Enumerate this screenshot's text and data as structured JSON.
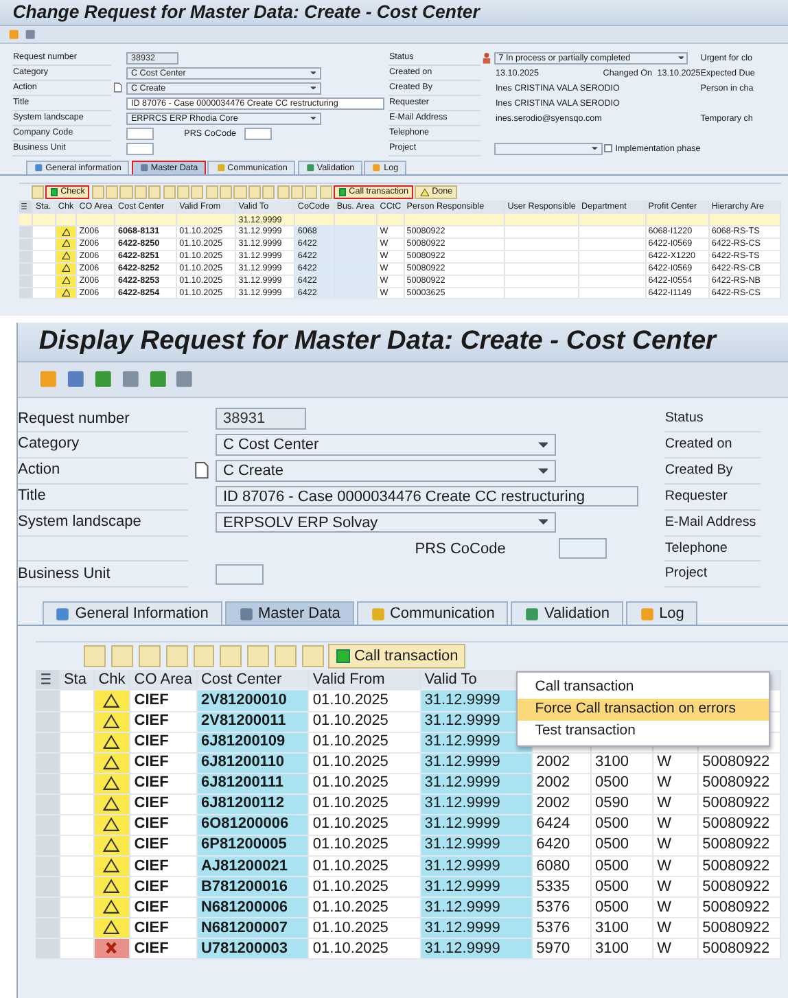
{
  "panels": [
    {
      "title": "Change Request for Master Data: Create - Cost Center",
      "form": [
        {
          "label": "Request number",
          "kind": "readonly",
          "value": "38932",
          "note_icon": false
        },
        {
          "label": "Category",
          "kind": "dropdown",
          "value": "C Cost Center",
          "note_icon": false
        },
        {
          "label": "Action",
          "kind": "dropdown",
          "value": "C Create",
          "note_icon": true
        },
        {
          "label": "Title",
          "kind": "long",
          "value": "ID 87076 - Case 0000034476 Create CC restructuring",
          "note_icon": false
        },
        {
          "label": "System landscape",
          "kind": "dropdown",
          "value": "ERPRCS ERP Rhodia Core",
          "note_icon": false
        },
        {
          "label": "Company Code",
          "kind": "small",
          "extra_label": "PRS CoCode",
          "note_icon": false
        },
        {
          "label": "Business Unit",
          "kind": "small",
          "note_icon": false
        }
      ],
      "side": [
        {
          "label": "Status",
          "kind": "dropdown",
          "value": "7 In process or partially completed",
          "status_icon": true
        },
        {
          "label": "Created on",
          "kind": "text",
          "value": "13.10.2025",
          "extra_label": "Changed On",
          "extra_value": "13.10.2025",
          "status_icon": false
        },
        {
          "label": "Created By",
          "kind": "text",
          "value": "Ines CRISTINA VALA SERODIO",
          "status_icon": false
        },
        {
          "label": "Requester",
          "kind": "text",
          "value": "Ines CRISTINA VALA SERODIO",
          "status_icon": false
        },
        {
          "label": "E-Mail Address",
          "kind": "text",
          "value": "ines.serodio@syensqo.com",
          "status_icon": false
        },
        {
          "label": "Telephone",
          "kind": "text",
          "status_icon": false
        },
        {
          "label": "Project",
          "kind": "dropdown",
          "checkbox_label": "Implementation phase",
          "checked": false,
          "status_icon": false
        }
      ],
      "edge": [
        "Urgent for clo",
        "Expected Due",
        "Person in cha",
        "Temporary ch"
      ],
      "tabs": [
        {
          "label": "General information",
          "selected": false,
          "highlighted": false
        },
        {
          "label": "Master Data",
          "selected": true,
          "highlighted": true
        },
        {
          "label": "Communication",
          "selected": false,
          "highlighted": false
        },
        {
          "label": "Validation",
          "selected": false,
          "highlighted": false
        },
        {
          "label": "Log",
          "selected": false,
          "highlighted": false
        }
      ],
      "grid_toolbar": [
        {
          "kind": "icon"
        },
        {
          "kind": "button",
          "label": "Check",
          "highlighted": true
        },
        {
          "kind": "icon"
        },
        {
          "kind": "icon"
        },
        {
          "kind": "icon"
        },
        {
          "kind": "icon"
        },
        {
          "kind": "icon"
        },
        {
          "kind": "icon"
        },
        {
          "kind": "icon"
        },
        {
          "kind": "icon"
        },
        {
          "kind": "icon"
        },
        {
          "kind": "icon"
        },
        {
          "kind": "icon"
        },
        {
          "kind": "icon"
        },
        {
          "kind": "icon"
        },
        {
          "kind": "icon"
        },
        {
          "kind": "icon"
        },
        {
          "kind": "icon"
        },
        {
          "kind": "icon"
        },
        {
          "kind": "button",
          "label": "Call transaction",
          "highlighted": true
        },
        {
          "kind": "warn_button",
          "label": "Done",
          "highlighted": false
        }
      ],
      "table": {
        "columns": [
          {
            "label": "Sta.",
            "shaded": false
          },
          {
            "label": "Chk"
          },
          {
            "label": "CO Area",
            "shaded": false,
            "bold": false
          },
          {
            "label": "Cost Center",
            "shaded": false,
            "bold": true
          },
          {
            "label": "Valid From",
            "shaded": false,
            "bold": false
          },
          {
            "label": "Valid To",
            "shaded": false,
            "bold": false
          },
          {
            "label": "CoCode",
            "shaded": true,
            "bold": false
          },
          {
            "label": "Bus. Area",
            "shaded": true
          },
          {
            "label": "CCtC",
            "shaded": false,
            "bold": false
          },
          {
            "label": "Person Responsible",
            "shaded": false,
            "bold": false
          },
          {
            "label": "User Responsible",
            "shaded": false
          },
          {
            "label": "Department",
            "shaded": false
          },
          {
            "label": "Profit Center",
            "shaded": false,
            "bold": false
          },
          {
            "label": "Hierarchy Are",
            "shaded": false,
            "bold": false
          }
        ],
        "filter_row": {
          "valid_to": "31.12.9999"
        },
        "rows": [
          {
            "kind": "warning",
            "co_area": "Z006",
            "cost_center": "6068-8131",
            "valid_from": "01.10.2025",
            "valid_to": "31.12.9999",
            "cocode": "6068",
            "cctc": "W",
            "person_responsible": "50080922",
            "profit_center": "6068-I1220",
            "hierarchy_area": "6068-RS-TS"
          },
          {
            "kind": "warning",
            "co_area": "Z006",
            "cost_center": "6422-8250",
            "valid_from": "01.10.2025",
            "valid_to": "31.12.9999",
            "cocode": "6422",
            "cctc": "W",
            "person_responsible": "50080922",
            "profit_center": "6422-I0569",
            "hierarchy_area": "6422-RS-CS"
          },
          {
            "kind": "warning",
            "co_area": "Z006",
            "cost_center": "6422-8251",
            "valid_from": "01.10.2025",
            "valid_to": "31.12.9999",
            "cocode": "6422",
            "cctc": "W",
            "person_responsible": "50080922",
            "profit_center": "6422-X1220",
            "hierarchy_area": "6422-RS-TS"
          },
          {
            "kind": "warning",
            "co_area": "Z006",
            "cost_center": "6422-8252",
            "valid_from": "01.10.2025",
            "valid_to": "31.12.9999",
            "cocode": "6422",
            "cctc": "W",
            "person_responsible": "50080922",
            "profit_center": "6422-I0569",
            "hierarchy_area": "6422-RS-CB"
          },
          {
            "kind": "warning",
            "co_area": "Z006",
            "cost_center": "6422-8253",
            "valid_from": "01.10.2025",
            "valid_to": "31.12.9999",
            "cocode": "6422",
            "cctc": "W",
            "person_responsible": "50080922",
            "profit_center": "6422-I0554",
            "hierarchy_area": "6422-RS-NB"
          },
          {
            "kind": "warning",
            "co_area": "Z006",
            "cost_center": "6422-8254",
            "valid_from": "01.10.2025",
            "valid_to": "31.12.9999",
            "cocode": "6422",
            "cctc": "W",
            "person_responsible": "50003625",
            "profit_center": "6422-I1149",
            "hierarchy_area": "6422-RS-CS"
          }
        ]
      }
    },
    {
      "title": "Display Request for Master Data: Create - Cost Center",
      "form": [
        {
          "label": "Request number",
          "kind": "readonly",
          "value": "38931",
          "note_icon": false
        },
        {
          "label": "Category",
          "kind": "dropdown",
          "value": "C Cost Center",
          "note_icon": false
        },
        {
          "label": "Action",
          "kind": "dropdown",
          "value": "C Create",
          "note_icon": true
        },
        {
          "label": "Title",
          "kind": "long",
          "value": "ID 87076 - Case 0000034476 Create CC restructuring",
          "note_icon": false
        },
        {
          "label": "System landscape",
          "kind": "dropdown",
          "value": "ERPSOLV ERP Solvay",
          "note_icon": false
        },
        {
          "kind": "none",
          "extra_label": "PRS CoCode",
          "note_icon": false
        },
        {
          "label": "Business Unit",
          "kind": "small",
          "note_icon": false
        }
      ],
      "side": [
        {
          "label": "Status",
          "kind": "label",
          "status_icon": false
        },
        {
          "label": "Created on",
          "kind": "label",
          "status_icon": false
        },
        {
          "label": "Created By",
          "kind": "label",
          "status_icon": false
        },
        {
          "label": "Requester",
          "kind": "label",
          "status_icon": false
        },
        {
          "label": "E-Mail Address",
          "kind": "label",
          "status_icon": false
        },
        {
          "label": "Telephone",
          "kind": "label",
          "status_icon": false
        },
        {
          "label": "Project",
          "kind": "label",
          "status_icon": false
        }
      ],
      "tabs": [
        {
          "label": "General Information",
          "selected": false,
          "highlighted": false
        },
        {
          "label": "Master Data",
          "selected": true,
          "highlighted": false
        },
        {
          "label": "Communication",
          "selected": false,
          "highlighted": false
        },
        {
          "label": "Validation",
          "selected": false,
          "highlighted": false
        },
        {
          "label": "Log",
          "selected": false,
          "highlighted": false
        }
      ],
      "grid_toolbar": [
        {
          "kind": "icon"
        },
        {
          "kind": "icon"
        },
        {
          "kind": "icon"
        },
        {
          "kind": "icon"
        },
        {
          "kind": "icon"
        },
        {
          "kind": "icon"
        },
        {
          "kind": "icon"
        },
        {
          "kind": "icon"
        },
        {
          "kind": "icon"
        },
        {
          "kind": "button",
          "label": "Call transaction",
          "highlighted": false
        }
      ],
      "table": {
        "columns": [
          {
            "label": "Sta",
            "shaded": false
          },
          {
            "label": "Chk"
          },
          {
            "label": "CO Area",
            "shaded": false,
            "bold": true
          },
          {
            "label": "Cost Center",
            "shaded": true,
            "bold": true
          },
          {
            "label": "Valid From",
            "shaded": false,
            "bold": false
          },
          {
            "label": "Valid To",
            "shaded": true,
            "bold": false
          },
          {
            "shaded": false,
            "bold": false
          },
          {
            "shaded": false,
            "bold": false
          },
          {
            "shaded": false,
            "bold": false
          },
          {
            "shaded": false,
            "bold": false
          }
        ],
        "rows": [
          {
            "kind": "warning",
            "co_area": "CIEF",
            "cost_center": "2V81200010",
            "valid_from": "01.10.2025",
            "valid_to": "31.12.9999"
          },
          {
            "kind": "warning",
            "co_area": "CIEF",
            "cost_center": "2V81200011",
            "valid_from": "01.10.2025",
            "valid_to": "31.12.9999"
          },
          {
            "kind": "warning",
            "co_area": "CIEF",
            "cost_center": "6J81200109",
            "valid_from": "01.10.2025",
            "valid_to": "31.12.9999"
          },
          {
            "kind": "warning",
            "co_area": "CIEF",
            "cost_center": "6J81200110",
            "valid_from": "01.10.2025",
            "valid_to": "31.12.9999",
            "column_7": "2002",
            "column_8": "3100",
            "column_9": "W",
            "column_10": "50080922"
          },
          {
            "kind": "warning",
            "co_area": "CIEF",
            "cost_center": "6J81200111",
            "valid_from": "01.10.2025",
            "valid_to": "31.12.9999",
            "column_7": "2002",
            "column_8": "0500",
            "column_9": "W",
            "column_10": "50080922"
          },
          {
            "kind": "warning",
            "co_area": "CIEF",
            "cost_center": "6J81200112",
            "valid_from": "01.10.2025",
            "valid_to": "31.12.9999",
            "column_7": "2002",
            "column_8": "0590",
            "column_9": "W",
            "column_10": "50080922"
          },
          {
            "kind": "warning",
            "co_area": "CIEF",
            "cost_center": "6O81200006",
            "valid_from": "01.10.2025",
            "valid_to": "31.12.9999",
            "column_7": "6424",
            "column_8": "0500",
            "column_9": "W",
            "column_10": "50080922"
          },
          {
            "kind": "warning",
            "co_area": "CIEF",
            "cost_center": "6P81200005",
            "valid_from": "01.10.2025",
            "valid_to": "31.12.9999",
            "column_7": "6420",
            "column_8": "0500",
            "column_9": "W",
            "column_10": "50080922"
          },
          {
            "kind": "warning",
            "co_area": "CIEF",
            "cost_center": "AJ81200021",
            "valid_from": "01.10.2025",
            "valid_to": "31.12.9999",
            "column_7": "6080",
            "column_8": "0500",
            "column_9": "W",
            "column_10": "50080922"
          },
          {
            "kind": "warning",
            "co_area": "CIEF",
            "cost_center": "B781200016",
            "valid_from": "01.10.2025",
            "valid_to": "31.12.9999",
            "column_7": "5335",
            "column_8": "0500",
            "column_9": "W",
            "column_10": "50080922"
          },
          {
            "kind": "warning",
            "co_area": "CIEF",
            "cost_center": "N681200006",
            "valid_from": "01.10.2025",
            "valid_to": "31.12.9999",
            "column_7": "5376",
            "column_8": "0500",
            "column_9": "W",
            "column_10": "50080922"
          },
          {
            "kind": "warning",
            "co_area": "CIEF",
            "cost_center": "N681200007",
            "valid_from": "01.10.2025",
            "valid_to": "31.12.9999",
            "column_7": "5376",
            "column_8": "3100",
            "column_9": "W",
            "column_10": "50080922"
          },
          {
            "kind": "error",
            "co_area": "CIEF",
            "cost_center": "U781200003",
            "valid_from": "01.10.2025",
            "valid_to": "31.12.9999",
            "column_7": "5970",
            "column_8": "3100",
            "column_9": "W",
            "column_10": "50080922"
          }
        ]
      },
      "menu": [
        {
          "label": "Call transaction",
          "selected": false
        },
        {
          "label": "Force Call transaction on errors",
          "selected": true
        },
        {
          "label": "Test transaction",
          "selected": false
        }
      ]
    }
  ]
}
